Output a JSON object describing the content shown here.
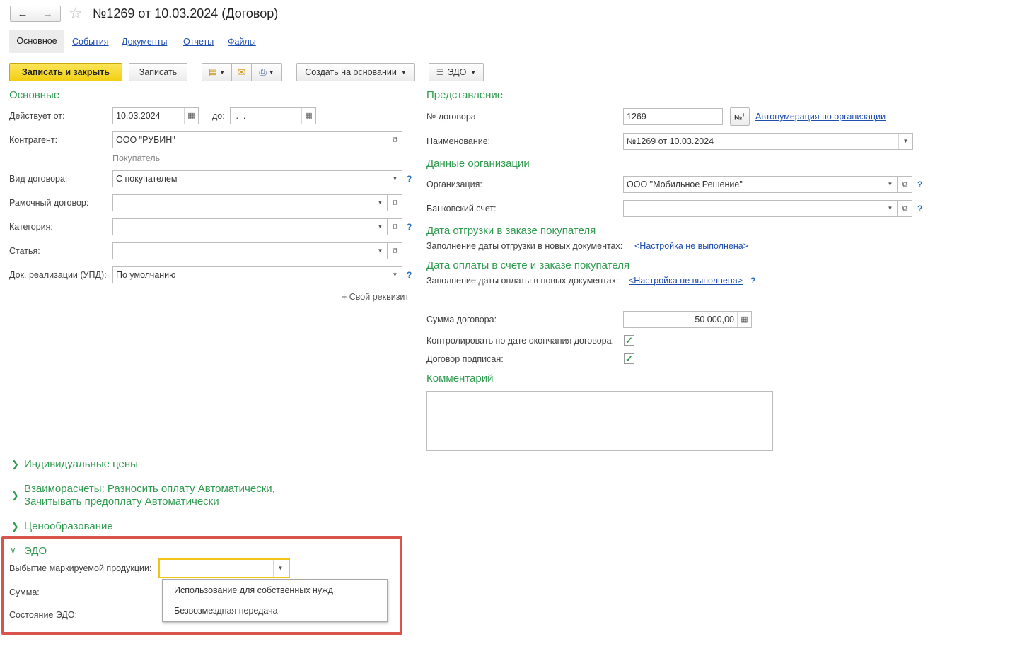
{
  "window": {
    "title": "№1269 от 10.03.2024 (Договор)"
  },
  "tabs": [
    {
      "label": "Основное"
    },
    {
      "label": "События"
    },
    {
      "label": "Документы"
    },
    {
      "label": "Отчеты"
    },
    {
      "label": "Файлы"
    }
  ],
  "toolbar": {
    "save_close": "Записать и закрыть",
    "save": "Записать",
    "create_based": "Создать на основании",
    "edo": "ЭДО"
  },
  "left": {
    "section_title": "Основные",
    "valid_from_label": "Действует от:",
    "valid_from": "10.03.2024",
    "to_label": "до:",
    "to_value": " .  .",
    "counterparty_label": "Контрагент:",
    "counterparty": "ООО \"РУБИН\"",
    "counterparty_role": "Покупатель",
    "contract_type_label": "Вид договора:",
    "contract_type": "С покупателем",
    "frame_label": "Рамочный договор:",
    "frame": "",
    "category_label": "Категория:",
    "category": "",
    "article_label": "Статья:",
    "article": "",
    "upd_label": "Док. реализации (УПД):",
    "upd": "По умолчанию",
    "own_attr": "+ Свой реквизит"
  },
  "right": {
    "section_title": "Представление",
    "number_label": "№ договора:",
    "number": "1269",
    "autonum_link": "Автонумерация по организации",
    "name_label": "Наименование:",
    "name": "№1269 от 10.03.2024",
    "org_section": "Данные организации",
    "org_label": "Организация:",
    "org": "ООО \"Мобильное Решение\"",
    "bank_label": "Банковский счет:",
    "bank": "",
    "ship_section": "Дата отгрузки в заказе покупателя",
    "ship_label": "Заполнение даты отгрузки в новых документах:",
    "ship_link": "<Настройка не выполнена>",
    "pay_section": "Дата оплаты в счете и заказе покупателя",
    "pay_label": "Заполнение даты оплаты в новых документах:",
    "pay_link": "<Настройка не выполнена>",
    "sum_label": "Сумма договора:",
    "sum": "50 000,00",
    "control_label": "Контролировать по дате окончания договора:",
    "signed_label": "Договор подписан:",
    "comment_section": "Комментарий"
  },
  "groups": {
    "prices": "Индивидуальные цены",
    "settle_1": "Взаиморасчеты: Разносить оплату Автоматически,",
    "settle_2": "Зачитывать предоплату Автоматически",
    "pricing": "Ценообразование"
  },
  "edo": {
    "title": "ЭДО",
    "marking_label": "Выбытие маркируемой продукции:",
    "sum_label": "Сумма:",
    "state_label": "Состояние ЭДО:",
    "options": [
      "Использование для собственных нужд",
      "Безвозмездная передача"
    ]
  },
  "colors": {
    "accent_green": "#2f9b4f",
    "highlight_red": "#d9534f",
    "primary_yellow": "#f7d51d"
  }
}
